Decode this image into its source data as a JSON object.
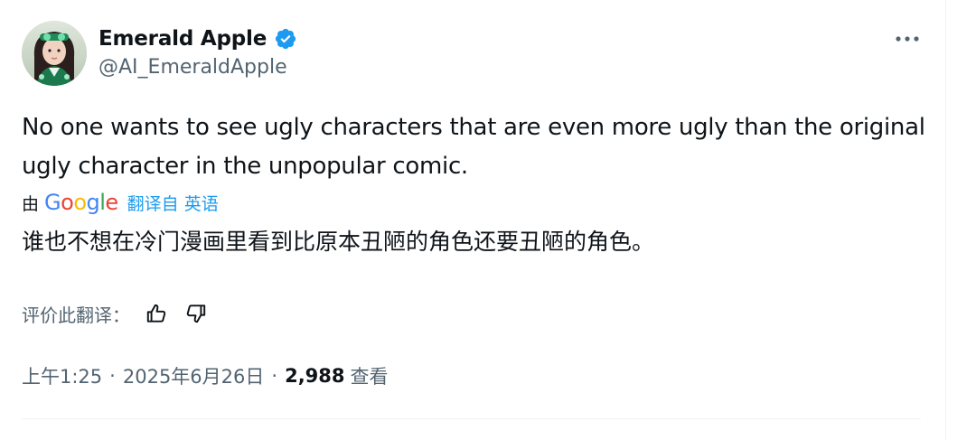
{
  "author": {
    "display_name": "Emerald Apple",
    "handle": "@AI_EmeraldApple",
    "verified": true
  },
  "tweet": {
    "text": "No one wants to see ugly characters that are even more ugly than the original ugly character in the unpopular comic."
  },
  "translation": {
    "by_label": "由",
    "provider": "Google",
    "translated_from_label": "翻译自 英语",
    "text": "谁也不想在冷门漫画里看到比原本丑陋的角色还要丑陋的角色。",
    "rate_label": "评价此翻译：",
    "thumbs_up_icon": "thumbs-up-icon",
    "thumbs_down_icon": "thumbs-down-icon"
  },
  "meta": {
    "time": "上午1:25",
    "separator": "·",
    "date": "2025年6月26日",
    "views_count": "2,988",
    "views_label": "查看"
  },
  "colors": {
    "text_primary": "#0f1419",
    "text_secondary": "#536471",
    "link": "#1d9bf0",
    "verified_badge": "#1d9bf0",
    "divider": "#eff3f4",
    "google_blue": "#4285f4",
    "google_red": "#ea4335",
    "google_yellow": "#fbbc05",
    "google_green": "#34a853"
  }
}
